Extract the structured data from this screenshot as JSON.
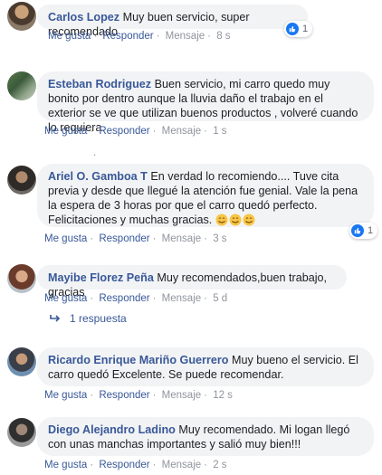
{
  "comments": [
    {
      "author": "Carlos Lopez",
      "text": "Muy buen servicio, super recomendado",
      "like": "Me gusta",
      "reply": "Responder",
      "message": "Mensaje",
      "time": "8 s",
      "reactions": "1"
    },
    {
      "author": "Esteban Rodriguez",
      "text": "Buen servicio, mi carro quedo muy bonito por dentro aunque la lluvia daño el trabajo en el exterior se ve que utilizan buenos productos , volveré cuando lo requiera.",
      "like": "Me gusta",
      "reply": "Responder",
      "message": "Mensaje",
      "time": "1 s"
    },
    {
      "author": "Ariel O. Gamboa T",
      "text": "En verdad lo recomiendo.... Tuve cita previa y desde que llegué la atención fue genial. Vale la pena la espera de 3 horas por que el carro quedó perfecto. Felicitaciones y muchas gracias.",
      "like": "Me gusta",
      "reply": "Responder",
      "message": "Mensaje",
      "time": "3 s",
      "reactions": "1"
    },
    {
      "author": "Mayibe Florez Peña",
      "text": "Muy recomendados,buen trabajo, gracias",
      "like": "Me gusta",
      "reply": "Responder",
      "message": "Mensaje",
      "time": "5 d",
      "replies": "1 respuesta"
    },
    {
      "author": "Ricardo Enrique Mariño Guerrero",
      "text": "Muy bueno el servicio. El carro quedó Excelente. Se puede recomendar.",
      "like": "Me gusta",
      "reply": "Responder",
      "message": "Mensaje",
      "time": "12 s"
    },
    {
      "author": "Diego Alejandro Ladino",
      "text": "Muy recomendado. Mi logan llegó con unas manchas importantes y salió muy bien!!!",
      "like": "Me gusta",
      "reply": "Responder",
      "message": "Mensaje",
      "time": "2 s"
    }
  ],
  "stray_dot": ".",
  "colors": {
    "link": "#385898",
    "bubble": "#f2f3f5",
    "muted": "#90949c",
    "like_blue": "#1877f2"
  },
  "icons": [
    "like-icon",
    "reply-arrow-icon",
    "smiling-face-icon"
  ]
}
